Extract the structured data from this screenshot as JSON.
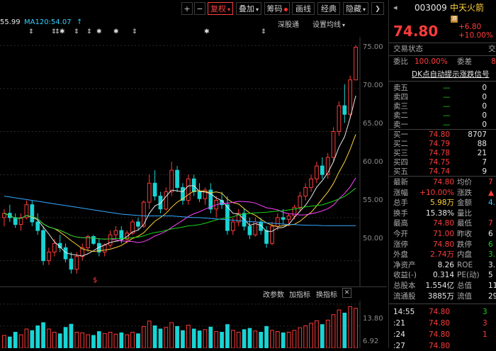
{
  "toolbar": {
    "plus": "+",
    "minus": "−",
    "fuquan": "复权",
    "diejia": "叠加",
    "chouma": "筹码",
    "huaxian": "画线",
    "jingdian": "经典",
    "yincang": "隐藏"
  },
  "ma_line": {
    "ma_prefix": "55.99",
    "ma120": "MA120:54.07",
    "arrow": "↑",
    "shengu": "深股通",
    "setting": "设置均线"
  },
  "price_axis": [
    "75.00",
    "70.00",
    "65.00",
    "60.00",
    "55.00",
    "50.00"
  ],
  "vol_axis": [
    "13.80",
    "6.92"
  ],
  "sub_toolbar": {
    "gaicanshu": "改参数",
    "jiazhibiao": "加指标",
    "huanzhibiao": "换指标",
    "close": "✕"
  },
  "colors": {
    "up": "#ff3b3b",
    "down": "#19d4d4",
    "ma5": "#e8e8e8",
    "ma10": "#ffd23a",
    "ma20": "#ff40ff",
    "ma30": "#19d419",
    "ma60": "#33aaff"
  },
  "chart_data": {
    "type": "candlestick",
    "ylim": [
      47,
      76
    ],
    "candles": [
      [
        55,
        56,
        54,
        55.5
      ],
      [
        55.5,
        56.5,
        54.5,
        55
      ],
      [
        55,
        55.5,
        53.8,
        54.2
      ],
      [
        54.2,
        55.5,
        53.5,
        55
      ],
      [
        55,
        57,
        54.8,
        56.5
      ],
      [
        56.5,
        57,
        54,
        54.5
      ],
      [
        54.5,
        55.5,
        53,
        53.5
      ],
      [
        53.5,
        54,
        49.5,
        50
      ],
      [
        50,
        51.5,
        49.5,
        51
      ],
      [
        51,
        52.5,
        50.5,
        52
      ],
      [
        52,
        53,
        51,
        51.5
      ],
      [
        51.5,
        52,
        49.8,
        50.2
      ],
      [
        50.2,
        51,
        48.5,
        49
      ],
      [
        49,
        51,
        48.5,
        50.5
      ],
      [
        50.5,
        52,
        50,
        51.5
      ],
      [
        51.5,
        53,
        51,
        52.8
      ],
      [
        52.8,
        53,
        51.8,
        52
      ],
      [
        52,
        52.5,
        50.5,
        51
      ],
      [
        51,
        52,
        50.5,
        51.8
      ],
      [
        51.8,
        53.5,
        51.5,
        53
      ],
      [
        53,
        54,
        52.5,
        53.5
      ],
      [
        53.5,
        54,
        52,
        52.5
      ],
      [
        52.5,
        53.5,
        52,
        53.2
      ],
      [
        53.2,
        54.8,
        53,
        54.5
      ],
      [
        54.5,
        55,
        53.5,
        54
      ],
      [
        54,
        57,
        53.8,
        56.8
      ],
      [
        56.8,
        60,
        56,
        59
      ],
      [
        59,
        60.5,
        57,
        57.5
      ],
      [
        57.5,
        58,
        55.5,
        56
      ],
      [
        56,
        58.5,
        55.8,
        58
      ],
      [
        58,
        61.5,
        57.5,
        60.5
      ],
      [
        60.5,
        61,
        58,
        58.5
      ],
      [
        58.5,
        59,
        56.5,
        57
      ],
      [
        57,
        60,
        56.5,
        59.5
      ],
      [
        59.5,
        60,
        57.5,
        58
      ],
      [
        58,
        59,
        56.8,
        57.2
      ],
      [
        57.2,
        58.5,
        56.5,
        58.2
      ],
      [
        58.2,
        59,
        55.5,
        56
      ],
      [
        56,
        57.5,
        55,
        57
      ],
      [
        57,
        58,
        56,
        56.5
      ],
      [
        56.5,
        57.5,
        53,
        53.5
      ],
      [
        53.5,
        55,
        53,
        54.5
      ],
      [
        54.5,
        56,
        54,
        55.5
      ],
      [
        55.5,
        56,
        53.5,
        54
      ],
      [
        54,
        55,
        52.5,
        53
      ],
      [
        53,
        55,
        52.8,
        54.5
      ],
      [
        54.5,
        55,
        53,
        53.5
      ],
      [
        53.5,
        54,
        51.5,
        52
      ],
      [
        52,
        54.5,
        51.8,
        54
      ],
      [
        54,
        55.5,
        53.5,
        55
      ],
      [
        55,
        56,
        54.2,
        54.8
      ],
      [
        54.8,
        55.5,
        54,
        55.2
      ],
      [
        55.2,
        56.5,
        54.8,
        56.2
      ],
      [
        56.2,
        58,
        55.8,
        57.5
      ],
      [
        57.5,
        59,
        57,
        58.5
      ],
      [
        58.5,
        60,
        58,
        59.5
      ],
      [
        59.5,
        61.5,
        59,
        61
      ],
      [
        61,
        62,
        59.5,
        60
      ],
      [
        60,
        62.5,
        59.5,
        62
      ],
      [
        62,
        65.5,
        61.5,
        65
      ],
      [
        65,
        68.5,
        64.5,
        68
      ],
      [
        68,
        70.5,
        66,
        67
      ],
      [
        67,
        71.5,
        66.5,
        71
      ],
      [
        71,
        75,
        71,
        74.8
      ]
    ],
    "ma_series": [
      {
        "name": "MA120",
        "values": [
          57.5,
          57.4,
          57.3,
          57.2,
          57.1,
          57,
          56.9,
          56.8,
          56.7,
          56.6,
          56.5,
          56.4,
          56.3,
          56.2,
          56.1,
          56,
          55.9,
          55.8,
          55.7,
          55.6,
          55.5,
          55.4,
          55.35,
          55.3,
          55.25,
          55.2,
          55.2,
          55.2,
          55.2,
          55.2,
          55.2,
          55.15,
          55.1,
          55.05,
          55,
          55,
          54.95,
          54.9,
          54.85,
          54.8,
          54.75,
          54.7,
          54.65,
          54.6,
          54.55,
          54.5,
          54.45,
          54.4,
          54.35,
          54.3,
          54.25,
          54.2,
          54.18,
          54.15,
          54.13,
          54.1,
          54.1,
          54.08,
          54.07,
          54.07,
          54.07,
          54.07,
          54.07,
          54.07
        ]
      }
    ],
    "volume": [
      4,
      3.5,
      5,
      4.2,
      6,
      5.5,
      7,
      8,
      6,
      5,
      4.5,
      6.5,
      7.5,
      5,
      4.8,
      4.2,
      4,
      5.2,
      4.6,
      5,
      4.4,
      4.8,
      4.2,
      5,
      4.5,
      6.8,
      8.5,
      7,
      6,
      6.5,
      8,
      6.8,
      5.5,
      7.2,
      6,
      5.4,
      5.8,
      6.6,
      5.2,
      5,
      7.4,
      5.6,
      5,
      5.8,
      6.2,
      5.4,
      5,
      6.8,
      5.6,
      5.2,
      4.8,
      5,
      5.6,
      6.4,
      7,
      7.8,
      8.6,
      7.4,
      8.8,
      10.5,
      12,
      11,
      13,
      12.5
    ]
  },
  "panel": {
    "code": "003009",
    "name": "中天火箭",
    "gang": "港",
    "price": "74.80",
    "change": "+6.80",
    "change_pct": "+10.00%",
    "jiaoyi_label": "交易状态",
    "jiaoyi_right": "交",
    "weibi_label": "委比",
    "weibi_val": "100.00%",
    "weicha_label": "委差",
    "weicha_val": "8",
    "dk_title": "DK点自动提示涨跌信号",
    "sell": [
      {
        "label": "卖五",
        "price": "—",
        "vol": "0"
      },
      {
        "label": "卖四",
        "price": "—",
        "vol": "0"
      },
      {
        "label": "卖三",
        "price": "—",
        "vol": "0"
      },
      {
        "label": "卖二",
        "price": "—",
        "vol": "0"
      },
      {
        "label": "卖一",
        "price": "—",
        "vol": "0"
      }
    ],
    "buy": [
      {
        "label": "买一",
        "price": "74.80",
        "vol": "8707"
      },
      {
        "label": "买二",
        "price": "74.79",
        "vol": "88"
      },
      {
        "label": "买三",
        "price": "74.78",
        "vol": "21"
      },
      {
        "label": "买四",
        "price": "74.75",
        "vol": "7"
      },
      {
        "label": "买五",
        "price": "74.74",
        "vol": "9"
      }
    ],
    "stats": [
      {
        "l1": "最新",
        "v1": "74.80",
        "c1": "red",
        "l2": "均价",
        "v2": "7",
        "c2": "red"
      },
      {
        "l1": "涨幅",
        "v1": "+10.00%",
        "c1": "red",
        "l2": "涨跌",
        "v2": "▲",
        "c2": "red"
      },
      {
        "l1": "总手",
        "v1": "5.98万",
        "c1": "yellow",
        "l2": "金额",
        "v2": "4.",
        "c2": "cyan"
      },
      {
        "l1": "换手",
        "v1": "15.38%",
        "c1": "white",
        "l2": "量比",
        "v2": "",
        "c2": "white"
      },
      {
        "l1": "最高",
        "v1": "74.80",
        "c1": "red",
        "l2": "最低",
        "v2": "7",
        "c2": "red"
      },
      {
        "l1": "今开",
        "v1": "71.00",
        "c1": "red",
        "l2": "昨收",
        "v2": "6",
        "c2": "white"
      },
      {
        "l1": "涨停",
        "v1": "74.80",
        "c1": "red",
        "l2": "跌停",
        "v2": "6",
        "c2": "green"
      },
      {
        "l1": "外盘",
        "v1": "2.74万",
        "c1": "red",
        "l2": "内盘",
        "v2": "3.",
        "c2": "green"
      },
      {
        "l1": "净资产",
        "v1": "8.26",
        "c1": "white",
        "l2": "ROE",
        "v2": "3.",
        "c2": "white"
      },
      {
        "l1": "收益(-)",
        "v1": "0.314",
        "c1": "white",
        "l2": "PE(动)",
        "v2": "5",
        "c2": "white"
      },
      {
        "l1": "总股本",
        "v1": "1.554亿",
        "c1": "white",
        "l2": "总值",
        "v2": "116",
        "c2": "white"
      },
      {
        "l1": "流通股",
        "v1": "3885万",
        "c1": "white",
        "l2": "流值",
        "v2": "29.",
        "c2": "white"
      }
    ],
    "ticks": [
      {
        "time": "14:55",
        "price": "74.80",
        "vol": "3",
        "vc": "green"
      },
      {
        "time": ":21",
        "price": "74.80",
        "vol": "3",
        "vc": "red"
      },
      {
        "time": ":24",
        "price": "74.80",
        "vol": "1",
        "vc": "red"
      },
      {
        "time": ":27",
        "price": "74.80",
        "vol": "",
        "vc": "red"
      }
    ]
  }
}
